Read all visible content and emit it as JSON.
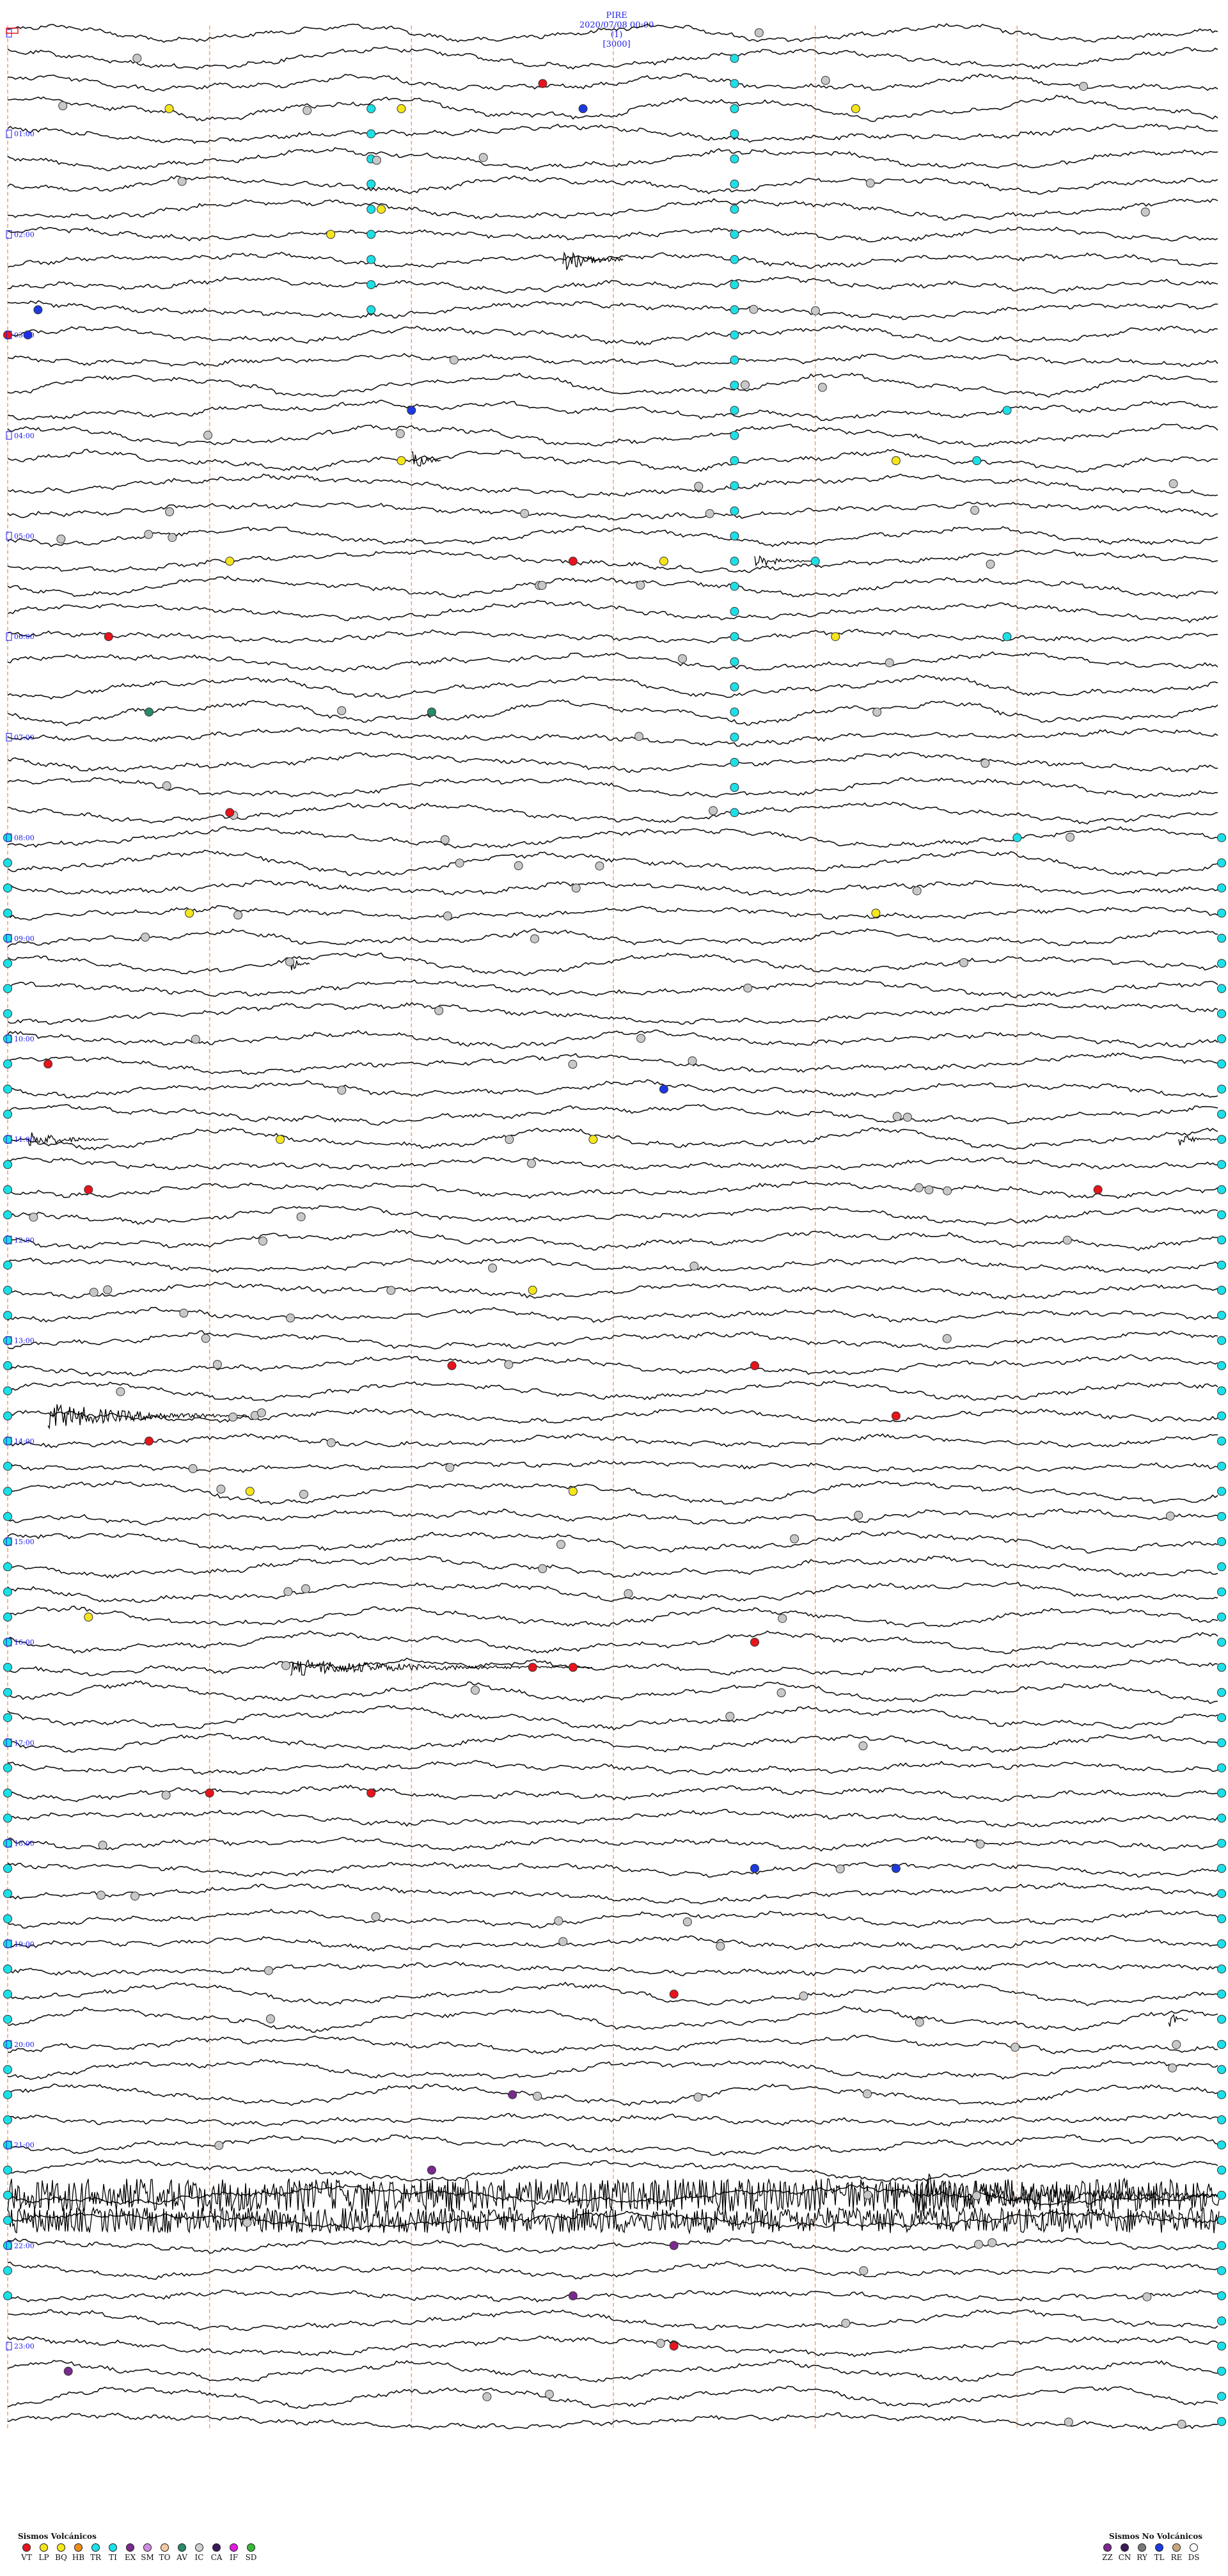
{
  "header": {
    "station": "PIRE",
    "datetime": "2020/07/08 00:00",
    "channel": "(1)",
    "scale": "[3000]"
  },
  "chart_data": {
    "type": "helicorder",
    "trace_count": 96,
    "hours": [
      "00:00",
      "01:00",
      "02:00",
      "03:00",
      "04:00",
      "05:00",
      "06:00",
      "07:00",
      "08:00",
      "09:00",
      "10:00",
      "11:00",
      "12:00",
      "13:00",
      "14:00",
      "15:00",
      "16:00",
      "17:00",
      "18:00",
      "19:00",
      "20:00",
      "21:00",
      "22:00",
      "23:00"
    ],
    "minute_marks": [
      10,
      20,
      30,
      40,
      50
    ],
    "events": [
      {
        "trace": 3,
        "min": 8,
        "c": "gold"
      },
      {
        "trace": 3,
        "min": 19.5,
        "c": "gold"
      },
      {
        "trace": 2,
        "min": 26.5,
        "c": "red"
      },
      {
        "trace": 3,
        "min": 28.5,
        "c": "blue"
      },
      {
        "trace": 3,
        "min": 42,
        "c": "gold"
      },
      {
        "trace": 7,
        "min": 18.5,
        "c": "gold"
      },
      {
        "trace": 8,
        "min": 16,
        "c": "gold"
      },
      {
        "trace": 11,
        "min": 1.5,
        "c": "blue"
      },
      {
        "trace": 12,
        "min": 0,
        "c": "red"
      },
      {
        "trace": 12,
        "min": 1,
        "c": "blue"
      },
      {
        "trace": 15,
        "min": 20,
        "c": "blue"
      },
      {
        "trace": 15,
        "min": 49.5,
        "c": "cyan"
      },
      {
        "trace": 17,
        "min": 19.5,
        "c": "gold"
      },
      {
        "trace": 17,
        "min": 44,
        "c": "gold"
      },
      {
        "trace": 17,
        "min": 48,
        "c": "cyan"
      },
      {
        "trace": 21,
        "min": 11,
        "c": "gold"
      },
      {
        "trace": 21,
        "min": 28,
        "c": "red"
      },
      {
        "trace": 21,
        "min": 32.5,
        "c": "gold"
      },
      {
        "trace": 21,
        "min": 40,
        "c": "cyan"
      },
      {
        "trace": 24,
        "min": 5,
        "c": "red"
      },
      {
        "trace": 24,
        "min": 41,
        "c": "gold"
      },
      {
        "trace": 24,
        "min": 49.5,
        "c": "cyan"
      },
      {
        "trace": 27,
        "min": 7,
        "c": "green"
      },
      {
        "trace": 27,
        "min": 21,
        "c": "green"
      },
      {
        "trace": 31,
        "min": 11,
        "c": "red"
      },
      {
        "trace": 32,
        "min": 50,
        "c": "cyan"
      },
      {
        "trace": 35,
        "min": 9,
        "c": "gold"
      },
      {
        "trace": 35,
        "min": 43,
        "c": "gold"
      },
      {
        "trace": 41,
        "min": 2,
        "c": "red"
      },
      {
        "trace": 42,
        "min": 32.5,
        "c": "blue"
      },
      {
        "trace": 44,
        "min": 29,
        "c": "gold"
      },
      {
        "trace": 44,
        "min": 13.5,
        "c": "gold"
      },
      {
        "trace": 46,
        "min": 4,
        "c": "red"
      },
      {
        "trace": 46,
        "min": 54,
        "c": "red"
      },
      {
        "trace": 50,
        "min": 26,
        "c": "gold"
      },
      {
        "trace": 53,
        "min": 22,
        "c": "red"
      },
      {
        "trace": 53,
        "min": 37,
        "c": "red"
      },
      {
        "trace": 55,
        "min": 44,
        "c": "red"
      },
      {
        "trace": 56,
        "min": 7,
        "c": "red"
      },
      {
        "trace": 58,
        "min": 12,
        "c": "gold"
      },
      {
        "trace": 58,
        "min": 28,
        "c": "gold"
      },
      {
        "trace": 63,
        "min": 4,
        "c": "gold"
      },
      {
        "trace": 64,
        "min": 37,
        "c": "red"
      },
      {
        "trace": 65,
        "min": 26,
        "c": "red"
      },
      {
        "trace": 65,
        "min": 28,
        "c": "red"
      },
      {
        "trace": 70,
        "min": 10,
        "c": "red"
      },
      {
        "trace": 70,
        "min": 18,
        "c": "red"
      },
      {
        "trace": 73,
        "min": 37,
        "c": "blue"
      },
      {
        "trace": 73,
        "min": 44,
        "c": "blue"
      },
      {
        "trace": 78,
        "min": 33,
        "c": "red"
      },
      {
        "trace": 82,
        "min": 25,
        "c": "purple"
      },
      {
        "trace": 85,
        "min": 21,
        "c": "purple"
      },
      {
        "trace": 88,
        "min": 33,
        "c": "purple"
      },
      {
        "trace": 90,
        "min": 28,
        "c": "purple"
      },
      {
        "trace": 92,
        "min": 33,
        "c": "red"
      },
      {
        "trace": 93,
        "min": 3,
        "c": "purple"
      }
    ],
    "bursts": [
      {
        "trace": 9,
        "min": 27.5,
        "len": 3,
        "amp": 22
      },
      {
        "trace": 17,
        "min": 20,
        "len": 1.5,
        "amp": 18
      },
      {
        "trace": 21,
        "min": 37,
        "len": 3,
        "amp": 10
      },
      {
        "trace": 37,
        "min": 14,
        "len": 1,
        "amp": 14
      },
      {
        "trace": 44,
        "min": 1,
        "len": 4,
        "amp": 14
      },
      {
        "trace": 44,
        "min": 58,
        "len": 2,
        "amp": 10
      },
      {
        "trace": 55,
        "min": 2,
        "len": 10,
        "amp": 22
      },
      {
        "trace": 65,
        "min": 14,
        "len": 15,
        "amp": 14
      },
      {
        "trace": 79,
        "min": 57.5,
        "len": 1,
        "amp": 14
      },
      {
        "trace": 86,
        "min": 0,
        "len": 60,
        "amp": 26
      },
      {
        "trace": 87,
        "min": 0,
        "len": 60,
        "amp": 20
      },
      {
        "trace": 86,
        "min": 45,
        "len": 15,
        "amp": 38
      }
    ],
    "cyan_columns": [
      {
        "min": 18,
        "from": 3,
        "to": 11
      },
      {
        "min": 36,
        "from": 1,
        "to": 31
      },
      {
        "min": 60,
        "from": 32,
        "to": 95
      },
      {
        "min": 0,
        "from": 32,
        "to": 90
      }
    ]
  },
  "legend_volcanic": {
    "title": "Sismos Volcánicos",
    "items": [
      {
        "label": "VT",
        "color": "#e8141c"
      },
      {
        "label": "LP",
        "color": "#f5e51c"
      },
      {
        "label": "BQ",
        "color": "#f5e51c"
      },
      {
        "label": "HB",
        "color": "#f08c1c"
      },
      {
        "label": "TR",
        "color": "#1ce0e8"
      },
      {
        "label": "TI",
        "color": "#1ce0e8"
      },
      {
        "label": "EX",
        "color": "#7a2a8c"
      },
      {
        "label": "SM",
        "color": "#d08ce0"
      },
      {
        "label": "TO",
        "color": "#f5c8a0"
      },
      {
        "label": "AV",
        "color": "#2a8a6a"
      },
      {
        "label": "IC",
        "color": "#d0d0d0"
      },
      {
        "label": "CA",
        "color": "#3a1a5a"
      },
      {
        "label": "IF",
        "color": "#e01ce0"
      },
      {
        "label": "SD",
        "color": "#3ab83a"
      }
    ]
  },
  "legend_nonvolcanic": {
    "title": "Sismos No Volcánicos",
    "items": [
      {
        "label": "ZZ",
        "color": "#7a2a8c"
      },
      {
        "label": "CN",
        "color": "#3a1a5a"
      },
      {
        "label": "RY",
        "color": "#7a7a7a"
      },
      {
        "label": "TL",
        "color": "#1c3ae0"
      },
      {
        "label": "RE",
        "color": "#c8a87a"
      },
      {
        "label": "DS",
        "color": "#ffffff"
      }
    ]
  },
  "colors": {
    "red": "#e8141c",
    "gold": "#f5e51c",
    "blue": "#1c3ae0",
    "cyan": "#1ce0e8",
    "green": "#2a8a6a",
    "purple": "#7a2a8c",
    "grey": "#c8c8c8"
  }
}
